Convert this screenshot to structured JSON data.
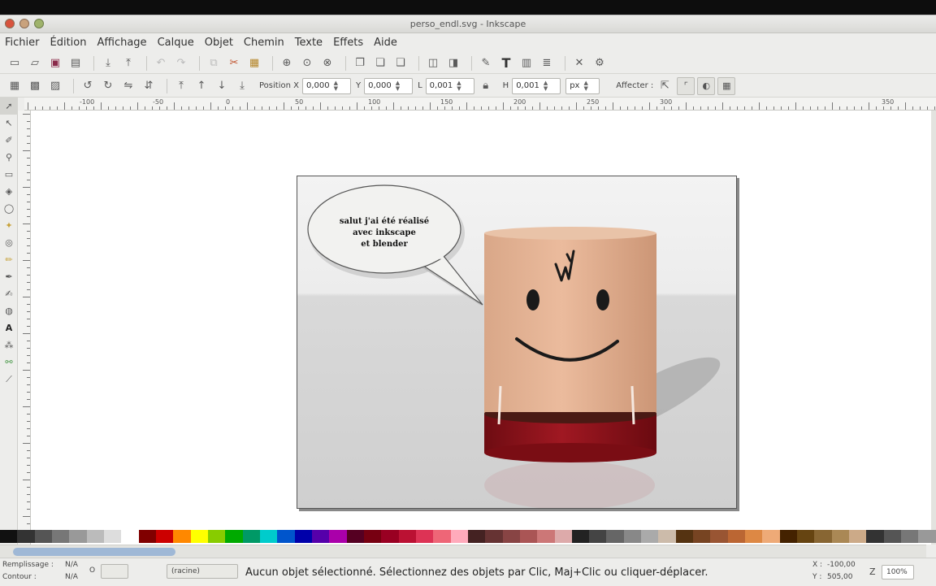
{
  "window": {
    "title": "perso_endl.svg - Inkscape"
  },
  "menu": [
    "Fichier",
    "Édition",
    "Affichage",
    "Calque",
    "Objet",
    "Chemin",
    "Texte",
    "Effets",
    "Aide"
  ],
  "commands_bar": {
    "icons": [
      "new-icon",
      "open-icon",
      "save-icon",
      "print-icon",
      "import-icon",
      "export-icon",
      "undo-icon",
      "redo-icon",
      "copy-icon",
      "cut-icon",
      "paste-icon",
      "zoom-selection-icon",
      "zoom-drawing-icon",
      "zoom-page-icon",
      "duplicate-icon",
      "clone-icon",
      "unlink-clone-icon",
      "group-icon",
      "ungroup-icon",
      "fill-stroke-icon",
      "text-tool-icon",
      "layers-icon",
      "align-icon",
      "xml-editor-icon",
      "preferences-icon"
    ]
  },
  "controls": {
    "pos_x_label": "Position X",
    "x_value": "0,000",
    "y_label": "Y",
    "y_value": "0,000",
    "l_label": "L",
    "l_value": "0,001",
    "h_label": "H",
    "h_value": "0,001",
    "unit": "px",
    "affect_label": "Affecter :"
  },
  "ruler": {
    "labels": [
      "-100",
      "-50",
      "0",
      "50",
      "100",
      "150",
      "200",
      "250",
      "300",
      "350"
    ]
  },
  "drawing": {
    "bubble_text_lines": [
      "salut j'ai été réalisé",
      "avec inkscape",
      "et blender"
    ],
    "bubble_color": "#f2f2f0",
    "body_color": "#e6b497",
    "pants_color": "#8e1018"
  },
  "palette": {
    "colors": [
      "#111111",
      "#333333",
      "#555555",
      "#777777",
      "#999999",
      "#bbbbbb",
      "#dddddd",
      "#ffffff",
      "#800000",
      "#cc0000",
      "#ff8800",
      "#ffff00",
      "#88cc00",
      "#00aa00",
      "#009966",
      "#00cccc",
      "#0055cc",
      "#0000aa",
      "#5500aa",
      "#aa00aa",
      "#550022",
      "#770011",
      "#990022",
      "#bb1133",
      "#dd3355",
      "#ee6677",
      "#ffaabb",
      "#442222",
      "#663333",
      "#884444",
      "#aa5555",
      "#cc7777",
      "#ddaaaa",
      "#222222",
      "#444444",
      "#666666",
      "#888888",
      "#aaaaaa",
      "#ccbbaa",
      "#553311",
      "#774422",
      "#995533",
      "#bb6633",
      "#dd8844",
      "#eeaa77",
      "#442200",
      "#664411",
      "#886633",
      "#aa8855",
      "#ccaa88",
      "#333333",
      "#555555",
      "#777777",
      "#999999"
    ]
  },
  "status": {
    "fill_label": "Remplissage :",
    "fill_value": "N/A",
    "stroke_label": "Contour :",
    "stroke_value": "N/A",
    "opacity_label": "O",
    "layer": "(racine)",
    "message": "Aucun objet sélectionné. Sélectionnez des objets par Clic, Maj+Clic ou cliquer-déplacer.",
    "x_label": "X :",
    "x_coord": "-100,00",
    "y_label": "Y :",
    "y_coord": "505,00",
    "zoom_label": "Z",
    "zoom": "100%"
  }
}
